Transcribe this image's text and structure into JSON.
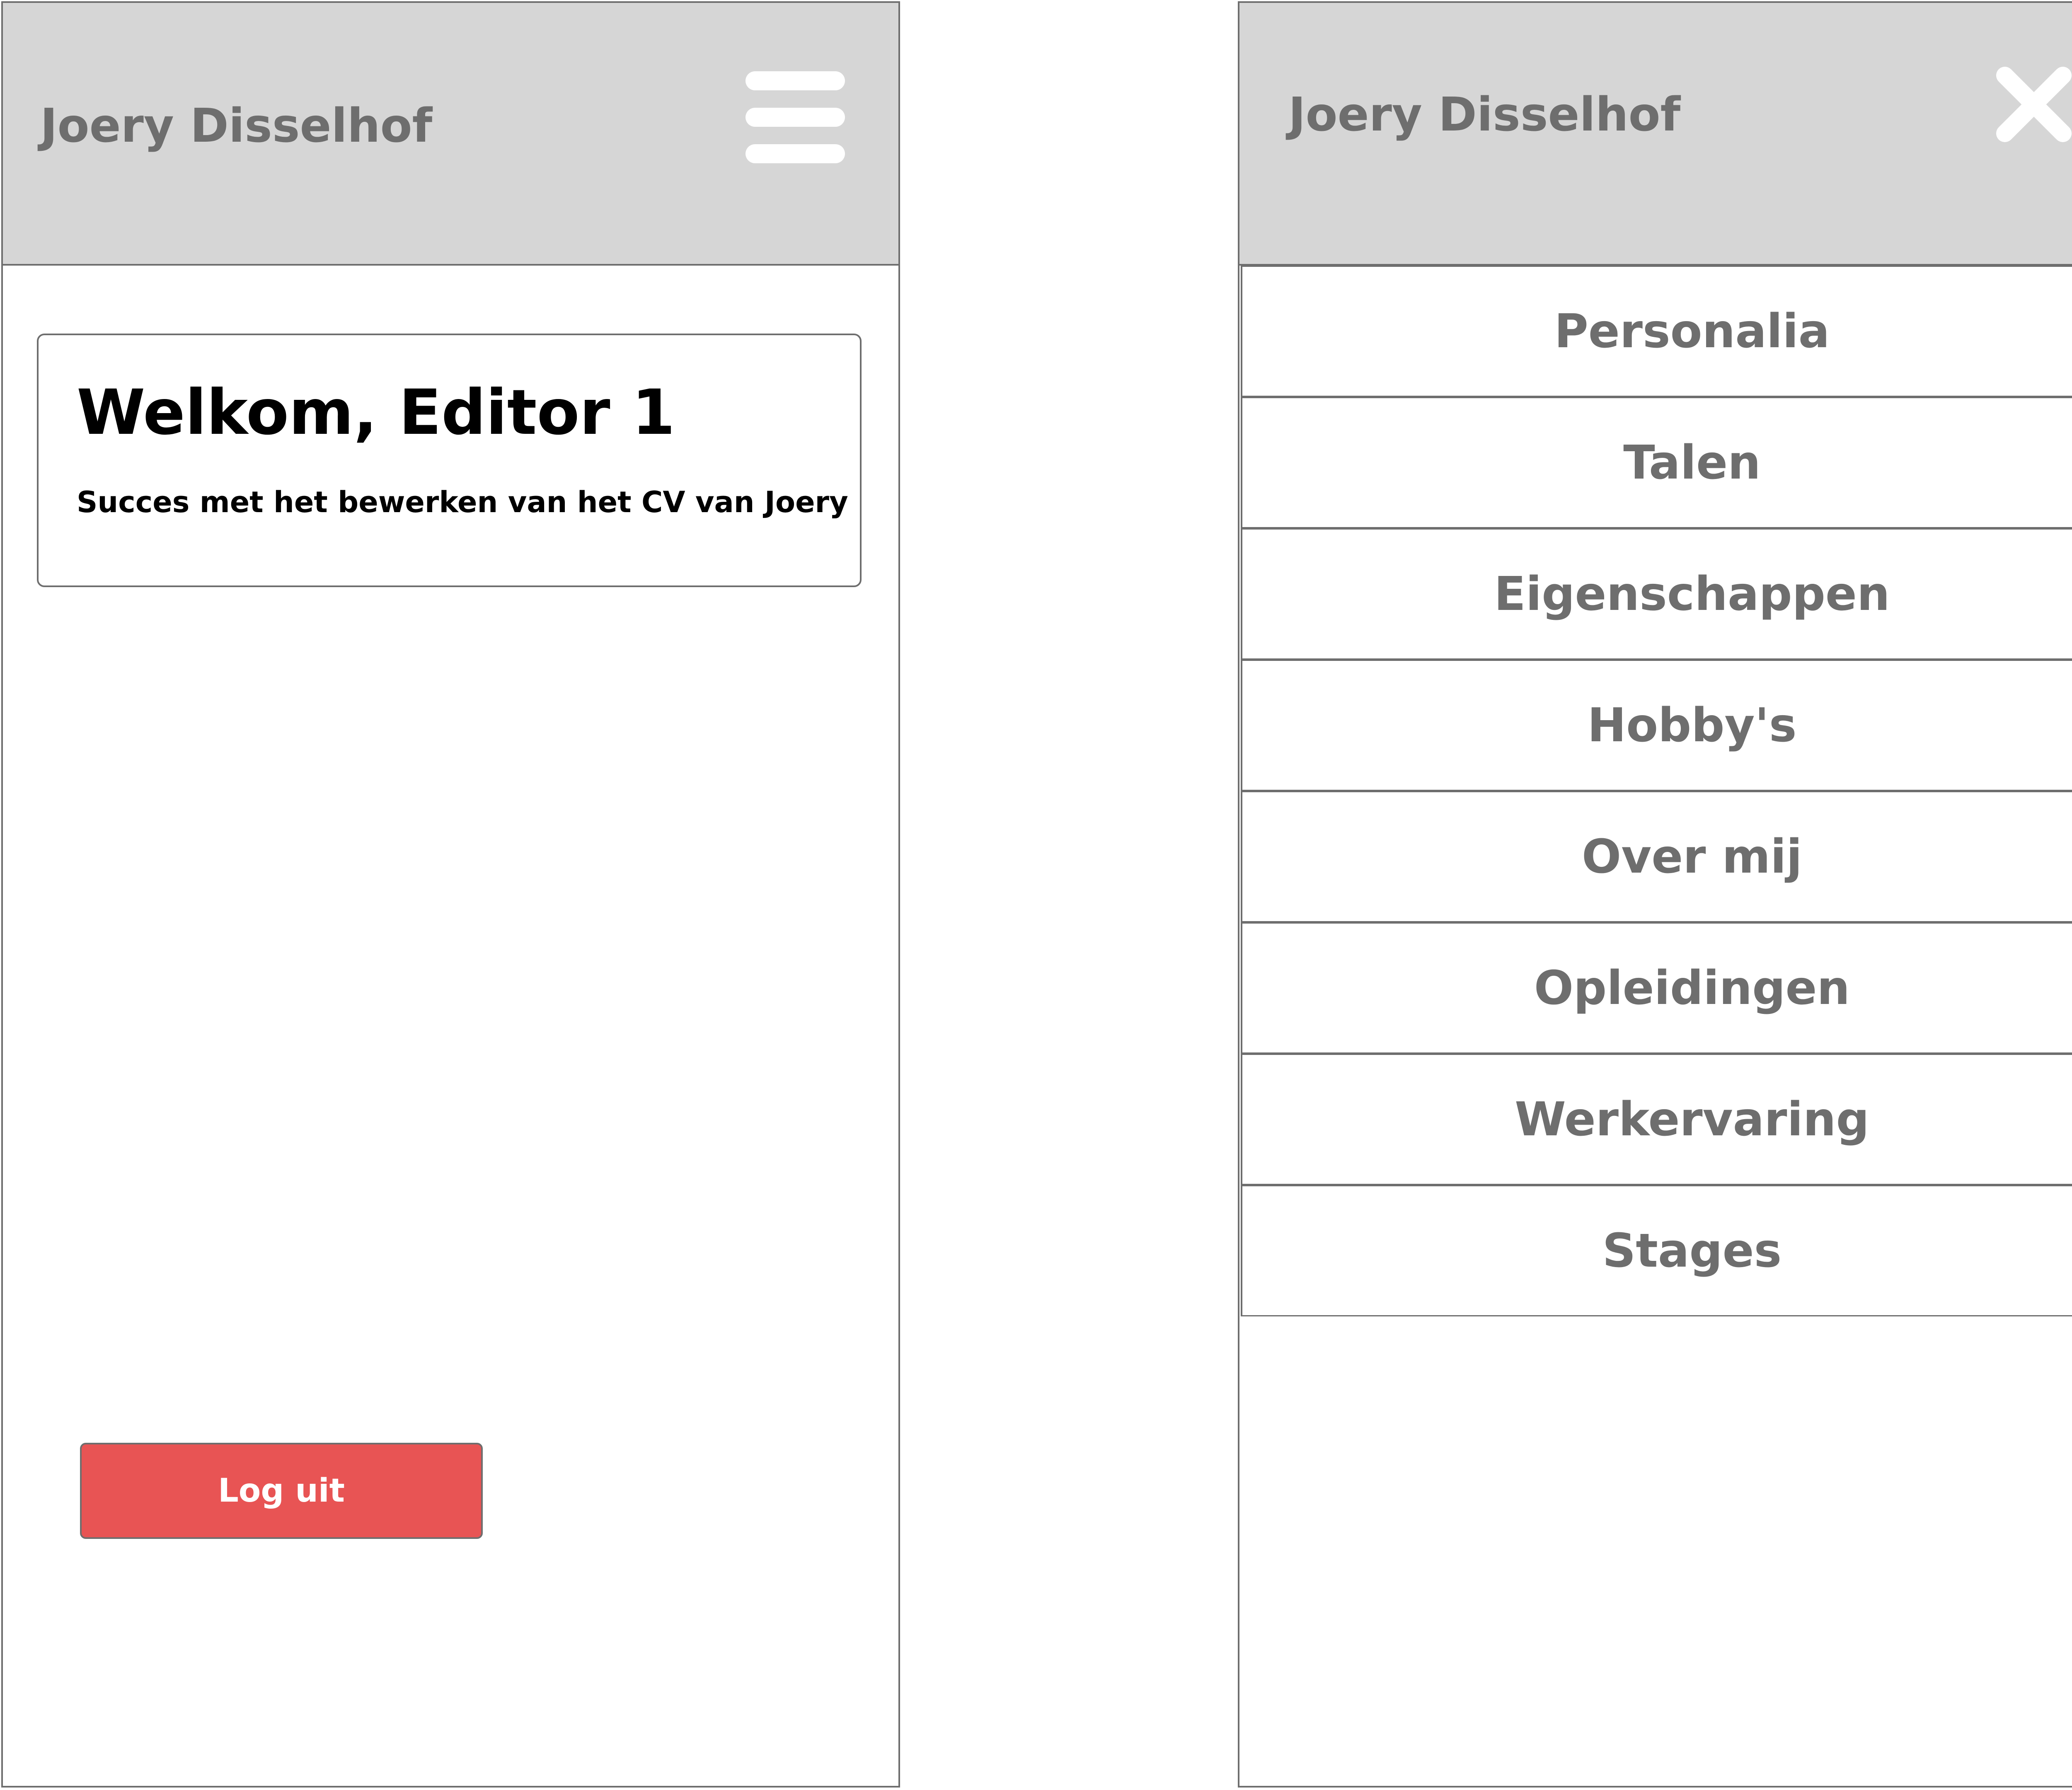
{
  "left_screen": {
    "header": {
      "title": "Joery Disselhof",
      "menu_icon": "hamburger-menu-icon"
    },
    "welcome": {
      "title": "Welkom, Editor 1",
      "subtitle": "Succes met het bewerken van het CV van Joery"
    },
    "logout": {
      "label": "Log uit",
      "color": "#e85454"
    }
  },
  "right_screen": {
    "header": {
      "title": "Joery Disselhof",
      "close_icon": "close-icon"
    },
    "menu": {
      "items": [
        {
          "label": "Personalia"
        },
        {
          "label": "Talen"
        },
        {
          "label": "Eigenschappen"
        },
        {
          "label": "Hobby's"
        },
        {
          "label": "Over mij"
        },
        {
          "label": "Opleidingen"
        },
        {
          "label": "Werkervaring"
        },
        {
          "label": "Stages"
        }
      ]
    }
  },
  "colors": {
    "header_background": "#d6d6d6",
    "border": "#6e6e6e",
    "text_muted": "#6e6e6e",
    "logout_button": "#e85454"
  }
}
